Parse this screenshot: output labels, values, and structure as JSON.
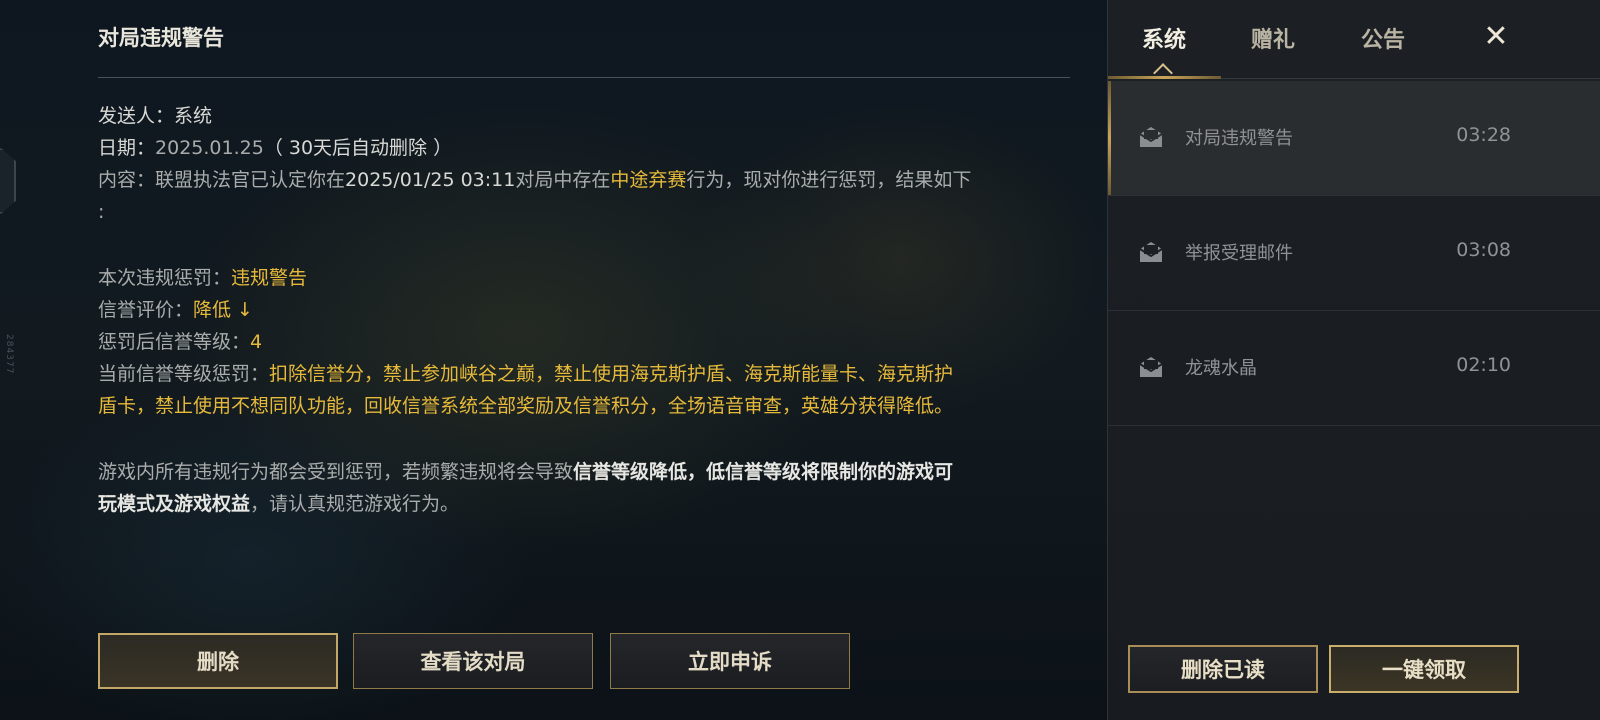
{
  "side_id": "284377",
  "mail_detail": {
    "title": "对局违规警告",
    "sender_label": "发送人：",
    "sender": "系统",
    "date_label": "日期：",
    "date": "2025.01.25",
    "date_note": "（ 30天后自动删除 ）",
    "content_label": "内容：",
    "content_pre": "联盟执法官已认定你在",
    "content_time": "2025/01/25 03:11",
    "content_mid": "对局中存在",
    "content_violation": "中途弃赛",
    "content_post": "行为，现对你进行惩罚，结果如下",
    "content_colon": ":",
    "penalty_label": "本次违规惩罚：",
    "penalty": "违规警告",
    "credit_label": "信誉评价：",
    "credit": "降低 ↓",
    "level_label": "惩罚后信誉等级：",
    "level": "4",
    "current_label": "当前信誉等级惩罚：",
    "current_line1": "扣除信誉分，禁止参加峡谷之巅，禁止使用海克斯护盾、海克斯能量卡、海克斯护",
    "current_line2": "盾卡，禁止使用不想同队功能，回收信誉系统全部奖励及信誉积分，全场语音审查，英雄分获得降低。",
    "notice_pre": "游戏内所有违规行为都会受到惩罚，若频繁违规将会导致",
    "notice_bold_line1": "信誉等级降低，低信誉等级将限制你的游戏可",
    "notice_bold_line2": "玩模式及游戏权益",
    "notice_post": "，请认真规范游戏行为。"
  },
  "actions": {
    "delete": "删除",
    "view_match": "查看该对局",
    "appeal": "立即申诉"
  },
  "tabs": [
    {
      "label": "系统",
      "active": true
    },
    {
      "label": "赠礼",
      "active": false
    },
    {
      "label": "公告",
      "active": false
    }
  ],
  "close_icon": "close-icon",
  "mail_list": [
    {
      "title": "对局违规警告",
      "time": "03:28",
      "selected": true
    },
    {
      "title": "举报受理邮件",
      "time": "03:08",
      "selected": false
    },
    {
      "title": "龙魂水晶",
      "time": "02:10",
      "selected": false
    }
  ],
  "list_actions": {
    "delete_read": "删除已读",
    "claim_all": "一键领取"
  },
  "colors": {
    "accent_gold": "#e6b93a",
    "button_border": "#c2a766"
  }
}
